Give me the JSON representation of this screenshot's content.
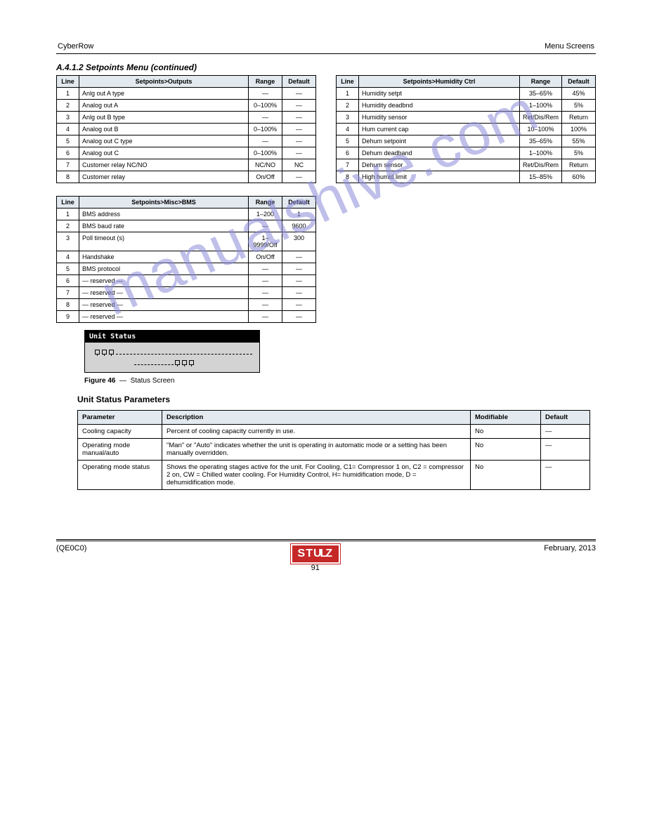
{
  "header": {
    "left": "CyberRow",
    "right": "Menu Screens"
  },
  "section_heading": "A.4.1.2     Setpoints Menu (continued)",
  "tables": {
    "outputs": {
      "headers": [
        "Line",
        "Setpoints>Outputs",
        "Range",
        "Default"
      ],
      "rows": [
        [
          "1",
          "Anlg out A type",
          "—",
          "—"
        ],
        [
          "2",
          "Analog out A",
          "0–100%",
          "—"
        ],
        [
          "3",
          "Anlg out B type",
          "—",
          "—"
        ],
        [
          "4",
          "Analog out B",
          "0–100%",
          "—"
        ],
        [
          "5",
          "Analog out C type",
          "—",
          "—"
        ],
        [
          "6",
          "Analog out C",
          "0–100%",
          "—"
        ],
        [
          "7",
          "Customer relay NC/NO",
          "NC/NO",
          "NC"
        ],
        [
          "8",
          "Customer relay",
          "On/Off",
          "—"
        ]
      ]
    },
    "humidity": {
      "headers": [
        "Line",
        "Setpoints>Humidity Ctrl",
        "Range",
        "Default"
      ],
      "rows": [
        [
          "1",
          "Humidity setpt",
          "35–65%",
          "45%"
        ],
        [
          "2",
          "Humidity deadbnd",
          "1–100%",
          "5%"
        ],
        [
          "3",
          "Humidity sensor",
          "Ret/Dis/Rem",
          "Return"
        ],
        [
          "4",
          "Hum current cap",
          "10–100%",
          "100%"
        ],
        [
          "5",
          "Dehum setpoint",
          "35–65%",
          "55%"
        ],
        [
          "6",
          "Dehum deadband",
          "1–100%",
          "5%"
        ],
        [
          "7",
          "Dehum sensor",
          "Ret/Dis/Rem",
          "Return"
        ],
        [
          "8",
          "High humid limit",
          "15–85%",
          "60%"
        ]
      ]
    },
    "bms": {
      "headers": [
        "Line",
        "Setpoints>Misc>BMS",
        "Range",
        "Default"
      ],
      "rows": [
        [
          "1",
          "BMS address",
          "1–200",
          "1"
        ],
        [
          "2",
          "BMS baud rate",
          "—",
          "9600"
        ],
        [
          "3",
          "Poll timeout (s)",
          "1–9999/Off",
          "300"
        ],
        [
          "4",
          "Handshake",
          "On/Off",
          "—"
        ],
        [
          "5",
          "BMS protocol",
          "—",
          "—"
        ],
        [
          "6",
          "— reserved —",
          "—",
          "—"
        ],
        [
          "7",
          "— reserved —",
          "—",
          "—"
        ],
        [
          "8",
          "— reserved —",
          "—",
          "—"
        ],
        [
          "9",
          "— reserved —",
          "—",
          "—"
        ]
      ]
    }
  },
  "status_box": {
    "title": "Unit Status",
    "fig_label": "Figure 46",
    "fig_text": "Status Screen"
  },
  "params_title": "Unit Status Parameters",
  "param_headers": [
    "Parameter",
    "Description",
    "Modifiable",
    "Default"
  ],
  "params": [
    {
      "p": "Cooling capacity",
      "d": "Percent of cooling capacity currently in use.",
      "m": "No",
      "def": "—"
    },
    {
      "p": "Operating mode manual/auto",
      "d": "\"Man\" or \"Auto\" indicates whether the unit is operating in automatic mode or a setting has been manually overridden.",
      "m": "No",
      "def": "—"
    },
    {
      "p": "Operating mode status",
      "d": "Shows the operating stages active for the unit. For Cooling, C1= Compressor 1 on, C2 = compressor 2 on, CW = Chilled water cooling. For Humidity Control, H= humidification mode, D = dehumidification mode.",
      "m": "No",
      "def": "—"
    }
  ],
  "footer": {
    "left": "(QE0C0)",
    "page": "91",
    "date": "February, 2013"
  },
  "watermark": "manualshive.com"
}
